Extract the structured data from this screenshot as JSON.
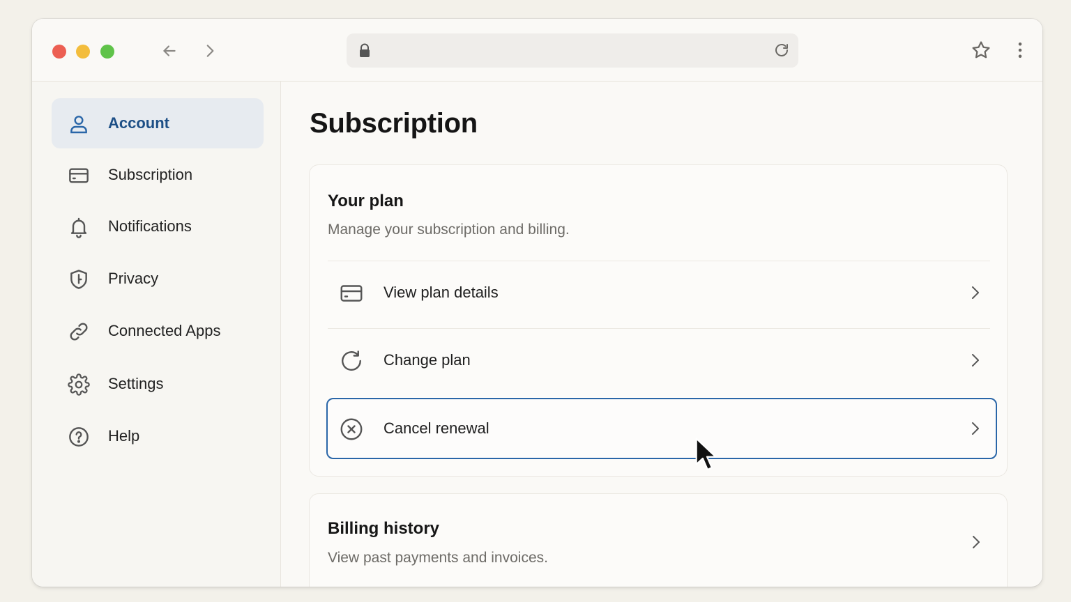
{
  "browser": {
    "url": "",
    "icons": [
      "close-light",
      "minimize-light",
      "zoom-light",
      "back-arrow-icon",
      "forward-arrow-icon",
      "lock-icon",
      "reload-icon",
      "star-icon",
      "more-vertical-icon"
    ]
  },
  "sidebar": {
    "items": [
      {
        "label": "Account",
        "icon": "user-icon",
        "active": true
      },
      {
        "label": "Subscription",
        "icon": "credit-card-icon"
      },
      {
        "label": "Notifications",
        "icon": "bell-icon"
      },
      {
        "label": "Privacy",
        "icon": "shield-icon"
      },
      {
        "label": "Connected Apps",
        "icon": "link-icon"
      },
      {
        "label": "Settings",
        "icon": "gear-icon"
      },
      {
        "label": "Help",
        "icon": "help-circle-icon"
      }
    ]
  },
  "main": {
    "title": "Subscription",
    "plan_card": {
      "title": "Your plan",
      "subtitle": "Manage your subscription and billing.",
      "rows": [
        {
          "label": "View plan details",
          "icon": "credit-card-icon"
        },
        {
          "label": "Change plan",
          "icon": "refresh-icon"
        },
        {
          "label": "Cancel renewal",
          "icon": "cancel-circle-icon",
          "focused": true
        }
      ]
    },
    "billing_card": {
      "title": "Billing history",
      "subtitle": "View past payments and invoices."
    }
  },
  "colors": {
    "accent": "#2a66a8",
    "active_nav_bg": "#e7ebf0",
    "active_nav_text": "#1d4f86",
    "close": "#ec5f52",
    "minimize": "#f3bd3c",
    "zoom": "#5fc349"
  }
}
